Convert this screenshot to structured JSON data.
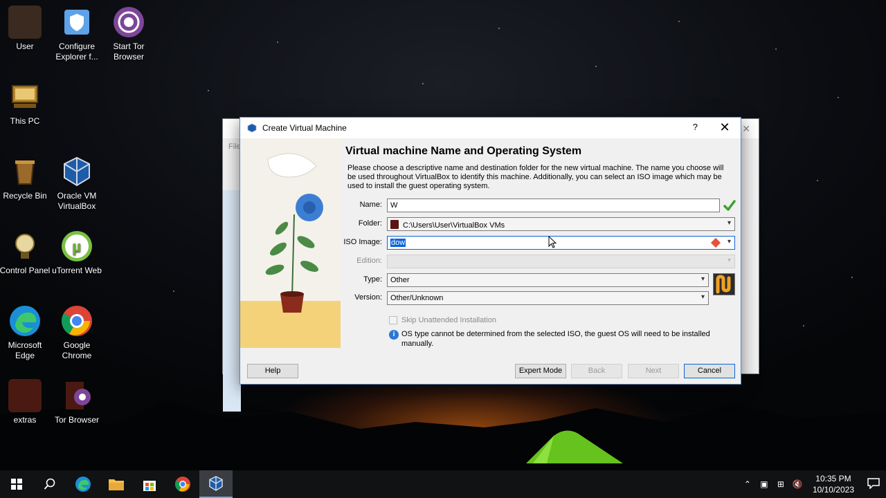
{
  "desktop": {
    "icons": [
      {
        "label": "User"
      },
      {
        "label": "Configure Explorer f..."
      },
      {
        "label": "Start Tor Browser"
      },
      {
        "label": "This PC"
      },
      {
        "label": "Recycle Bin"
      },
      {
        "label": "Oracle VM VirtualBox"
      },
      {
        "label": "Control Panel"
      },
      {
        "label": "uTorrent Web"
      },
      {
        "label": "Microsoft Edge"
      },
      {
        "label": "Google Chrome"
      },
      {
        "label": "extras"
      },
      {
        "label": "Tor Browser"
      }
    ]
  },
  "background_window": {
    "menu_fragment": "File"
  },
  "dialog": {
    "title": "Create Virtual Machine",
    "help_glyph": "?",
    "close_glyph": "✕",
    "heading": "Virtual machine Name and Operating System",
    "description": "Please choose a descriptive name and destination folder for the new virtual machine. The name you choose will be used throughout VirtualBox to identify this machine. Additionally, you can select an ISO image which may be used to install the guest operating system.",
    "fields": {
      "name_label": "Name:",
      "name_value": "W",
      "folder_label": "Folder:",
      "folder_value": "C:\\Users\\User\\VirtualBox VMs",
      "iso_label": "ISO Image:",
      "iso_value": "dow",
      "edition_label": "Edition:",
      "edition_value": "",
      "type_label": "Type:",
      "type_value": "Other",
      "version_label": "Version:",
      "version_value": "Other/Unknown"
    },
    "skip_unattended_label": "Skip Unattended Installation",
    "skip_unattended_checked": false,
    "info_message": "OS type cannot be determined from the selected ISO, the guest OS will need to be installed manually.",
    "buttons": {
      "help": "Help",
      "expert_mode": "Expert Mode",
      "back": "Back",
      "next": "Next",
      "cancel": "Cancel"
    }
  },
  "taskbar": {
    "apps": [
      "windows-start",
      "search",
      "edge",
      "file-explorer",
      "microsoft-store",
      "chrome",
      "virtualbox"
    ],
    "time": "10:35 PM",
    "date": "10/10/2023"
  },
  "colors": {
    "accent": "#0a64d8",
    "info": "#2a78d6",
    "valid": "#3aa12c",
    "taskbar": "#101214"
  }
}
